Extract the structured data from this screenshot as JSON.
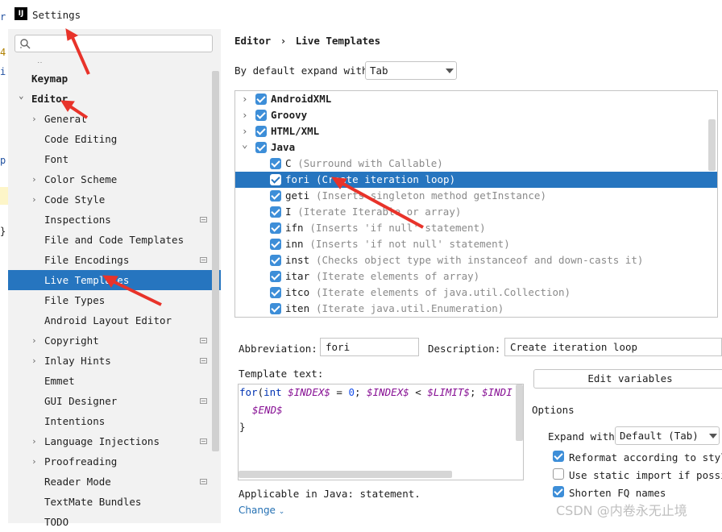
{
  "window": {
    "title": "Settings",
    "app_icon": "IJ"
  },
  "editor_strip": {
    "chars": [
      "r",
      "4",
      "i",
      "p",
      "}"
    ]
  },
  "sidebar": {
    "search_placeholder": "",
    "truncated_top": "‥",
    "items": [
      {
        "label": "Keymap",
        "level": 0,
        "bold": true,
        "expandable": false
      },
      {
        "label": "Editor",
        "level": 0,
        "bold": true,
        "expandable": true,
        "expanded": true
      },
      {
        "label": "General",
        "level": 1,
        "expandable": true
      },
      {
        "label": "Code Editing",
        "level": 1
      },
      {
        "label": "Font",
        "level": 1
      },
      {
        "label": "Color Scheme",
        "level": 1,
        "expandable": true
      },
      {
        "label": "Code Style",
        "level": 1,
        "expandable": true
      },
      {
        "label": "Inspections",
        "level": 1,
        "page_icon": true
      },
      {
        "label": "File and Code Templates",
        "level": 1
      },
      {
        "label": "File Encodings",
        "level": 1,
        "page_icon": true
      },
      {
        "label": "Live Templates",
        "level": 1,
        "selected": true
      },
      {
        "label": "File Types",
        "level": 1
      },
      {
        "label": "Android Layout Editor",
        "level": 1
      },
      {
        "label": "Copyright",
        "level": 1,
        "expandable": true,
        "page_icon": true
      },
      {
        "label": "Inlay Hints",
        "level": 1,
        "expandable": true,
        "page_icon": true
      },
      {
        "label": "Emmet",
        "level": 1
      },
      {
        "label": "GUI Designer",
        "level": 1,
        "page_icon": true
      },
      {
        "label": "Intentions",
        "level": 1
      },
      {
        "label": "Language Injections",
        "level": 1,
        "expandable": true,
        "page_icon": true
      },
      {
        "label": "Proofreading",
        "level": 1,
        "expandable": true
      },
      {
        "label": "Reader Mode",
        "level": 1,
        "page_icon": true
      },
      {
        "label": "TextMate Bundles",
        "level": 1
      },
      {
        "label": "TODO",
        "level": 1
      }
    ]
  },
  "breadcrumb": {
    "parent": "Editor",
    "separator": "›",
    "current": "Live Templates"
  },
  "expand_default": {
    "label": "By default expand with",
    "value": "Tab"
  },
  "templates": [
    {
      "kind": "group",
      "name": "AndroidXML",
      "expanded": false,
      "checked": true
    },
    {
      "kind": "group",
      "name": "Groovy",
      "expanded": false,
      "checked": true
    },
    {
      "kind": "group",
      "name": "HTML/XML",
      "expanded": false,
      "checked": true
    },
    {
      "kind": "group",
      "name": "Java",
      "expanded": true,
      "checked": true
    },
    {
      "kind": "item",
      "abbr": "C",
      "desc": "(Surround with Callable)",
      "checked": true
    },
    {
      "kind": "item",
      "abbr": "fori",
      "desc": "(Create iteration loop)",
      "checked": true,
      "selected": true
    },
    {
      "kind": "item",
      "abbr": "geti",
      "desc": "(Inserts singleton method getInstance)",
      "checked": true
    },
    {
      "kind": "item",
      "abbr": "I",
      "desc": "(Iterate Iterable or array)",
      "checked": true
    },
    {
      "kind": "item",
      "abbr": "ifn",
      "desc": "(Inserts 'if null' statement)",
      "checked": true
    },
    {
      "kind": "item",
      "abbr": "inn",
      "desc": "(Inserts 'if not null' statement)",
      "checked": true
    },
    {
      "kind": "item",
      "abbr": "inst",
      "desc": "(Checks object type with instanceof and down-casts it)",
      "checked": true
    },
    {
      "kind": "item",
      "abbr": "itar",
      "desc": "(Iterate elements of array)",
      "checked": true
    },
    {
      "kind": "item",
      "abbr": "itco",
      "desc": "(Iterate elements of java.util.Collection)",
      "checked": true
    },
    {
      "kind": "item",
      "abbr": "iten",
      "desc": "(Iterate java.util.Enumeration)",
      "checked": true
    }
  ],
  "details": {
    "abbreviation_label": "Abbreviation:",
    "abbreviation_value": "fori",
    "description_label": "Description:",
    "description_value": "Create iteration loop",
    "template_text_label": "Template text:",
    "code": {
      "l1": {
        "kw1": "for",
        "p1": "(",
        "kw2": "int",
        "v1": "$INDEX$",
        "p2": " = ",
        "n1": "0",
        "p3": "; ",
        "v2": "$INDEX$",
        "p4": " < ",
        "v3": "$LIMIT$",
        "p5": "; ",
        "v4": "$INDI"
      },
      "l2": "$END$",
      "l3": "}"
    },
    "edit_variables": "Edit variables",
    "options_label": "Options",
    "expand_with_label": "Expand with",
    "expand_with_value": "Default (Tab)",
    "reformat": {
      "label": "Reformat according to style",
      "checked": true
    },
    "static_import": {
      "label": "Use static import if possible",
      "checked": false
    },
    "shorten_fq": {
      "label": "Shorten FQ names",
      "checked": true
    },
    "applicable": "Applicable in Java: statement.",
    "change": "Change"
  },
  "watermark": "CSDN @内卷永无止境",
  "colors": {
    "selection": "#2675bf",
    "checkbox": "#3d8ed8",
    "annotation_arrow": "#e8332a"
  }
}
